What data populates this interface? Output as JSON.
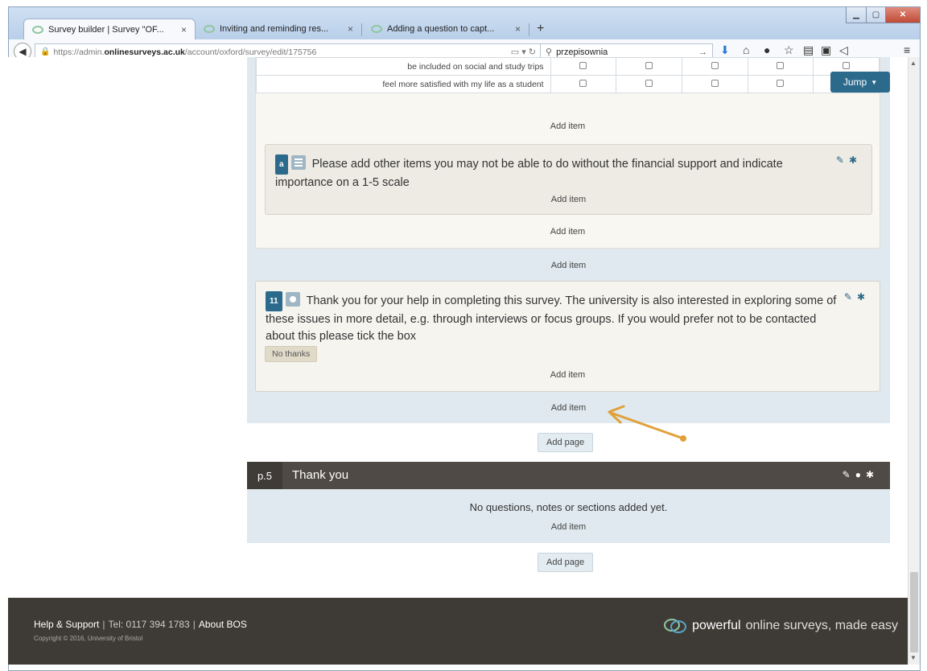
{
  "tabs": [
    {
      "label": "Survey builder | Survey \"OF...",
      "close": "×"
    },
    {
      "label": "Inviting and reminding res...",
      "close": "×"
    },
    {
      "label": "Adding a question to capt...",
      "close": "×"
    }
  ],
  "newtab": "+",
  "url": {
    "prefix": "https://admin.",
    "domain": "onlinesurveys.ac.uk",
    "path": "/account/oxford/survey/edit/175756"
  },
  "search": {
    "value": "przepisownia"
  },
  "jump": {
    "label": "Jump"
  },
  "matrix_rows": [
    {
      "label": "be included on social and study trips"
    },
    {
      "label": "feel more satisfied with my life as a student"
    }
  ],
  "add_item": "Add item",
  "add_page": "Add page",
  "question_a": {
    "badge": "a",
    "text": "Please add other items you may not be able to do without the financial support and indicate importance on a 1-5 scale"
  },
  "question_11": {
    "badge": "11",
    "text": "Thank you for your help in completing this survey. The university is also interested in exploring some of these issues in more detail, e.g. through interviews or focus groups. If you would prefer not to be contacted about this please tick the box",
    "option": "No thanks"
  },
  "page5": {
    "number": "p.5",
    "title": "Thank you",
    "empty": "No questions, notes or sections added yet."
  },
  "footer": {
    "help": "Help & Support",
    "tel": "Tel: 0117 394 1783",
    "about": "About BOS",
    "copyright": "Copyright © 2016, University of Bristol",
    "brand_strong": "powerful",
    "brand_rest": "online surveys, made easy"
  },
  "colors": {
    "accent": "#2c6a8c",
    "arrow": "#e0a13a",
    "footer": "#3e3b36",
    "page_bg": "#dfe9ef"
  }
}
